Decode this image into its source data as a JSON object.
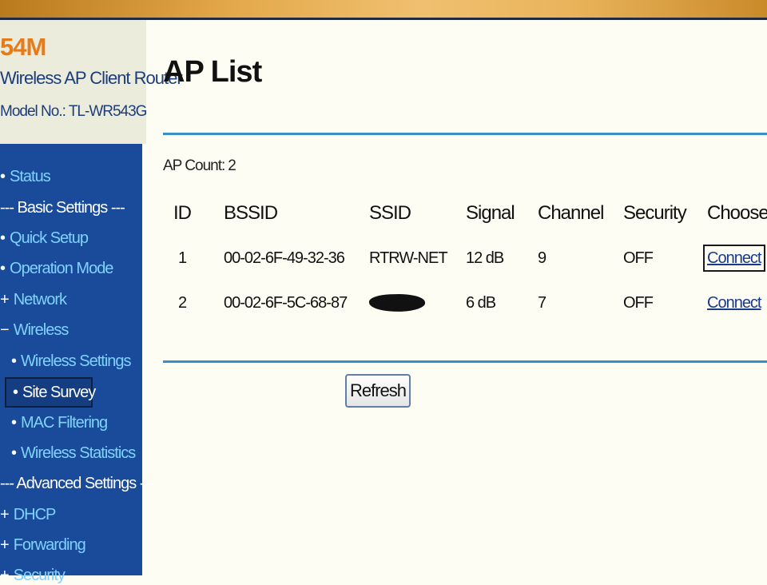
{
  "brand": {
    "speed": "54M",
    "product": "Wireless AP Client Router",
    "model_label": "Model No.:",
    "model_value": "TL-WR543G"
  },
  "sidebar": {
    "items": [
      {
        "label": "Status",
        "type": "link"
      },
      {
        "label": "--- Basic Settings ---",
        "type": "header"
      },
      {
        "label": "Quick Setup",
        "type": "link"
      },
      {
        "label": "Operation Mode",
        "type": "link"
      },
      {
        "label": "Network",
        "type": "expandable"
      },
      {
        "label": "Wireless",
        "type": "expanded"
      },
      {
        "label": "Wireless Settings",
        "type": "sub"
      },
      {
        "label": "Site Survey",
        "type": "sub-active"
      },
      {
        "label": "MAC Filtering",
        "type": "sub"
      },
      {
        "label": "Wireless Statistics",
        "type": "sub"
      },
      {
        "label": "--- Advanced Settings ---",
        "type": "header"
      },
      {
        "label": "DHCP",
        "type": "expandable"
      },
      {
        "label": "Forwarding",
        "type": "expandable"
      },
      {
        "label": "Security",
        "type": "expandable"
      }
    ]
  },
  "main": {
    "title": "AP List",
    "ap_count_label": "AP Count:",
    "ap_count_value": "2",
    "table": {
      "headers": [
        "ID",
        "BSSID",
        "SSID",
        "Signal",
        "Channel",
        "Security",
        "Choose"
      ],
      "rows": [
        {
          "id": "1",
          "bssid": "00-02-6F-49-32-36",
          "ssid": "RTRW-NET",
          "signal": "12 dB",
          "channel": "9",
          "security": "OFF",
          "choose": "Connect"
        },
        {
          "id": "2",
          "bssid": "00-02-6F-5C-68-87",
          "ssid": "",
          "signal": "6 dB",
          "channel": "7",
          "security": "OFF",
          "choose": "Connect"
        }
      ]
    },
    "refresh_label": "Refresh"
  },
  "colors": {
    "sidebar_bg": "#1a4a9a",
    "nav_link": "#7fd2ff",
    "accent_rule": "#3a8fc8",
    "brand_orange": "#e77b1a",
    "brand_blue": "#1c3d7a"
  }
}
